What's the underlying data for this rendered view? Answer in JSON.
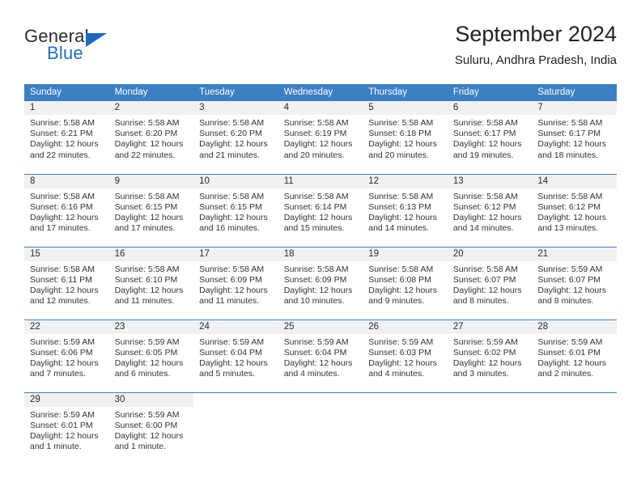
{
  "brand": {
    "line1": "General",
    "line2": "Blue",
    "accent_color": "#1a69bd"
  },
  "header": {
    "title": "September 2024",
    "subtitle": "Suluru, Andhra Pradesh, India"
  },
  "grid": {
    "header_bg": "#3b7fc4",
    "daynum_bg": "#f1f1f1",
    "weekdays": [
      "Sunday",
      "Monday",
      "Tuesday",
      "Wednesday",
      "Thursday",
      "Friday",
      "Saturday"
    ]
  },
  "weeks": [
    [
      {
        "day": "1",
        "sunrise": "Sunrise: 5:58 AM",
        "sunset": "Sunset: 6:21 PM",
        "daylight1": "Daylight: 12 hours",
        "daylight2": "and 22 minutes."
      },
      {
        "day": "2",
        "sunrise": "Sunrise: 5:58 AM",
        "sunset": "Sunset: 6:20 PM",
        "daylight1": "Daylight: 12 hours",
        "daylight2": "and 22 minutes."
      },
      {
        "day": "3",
        "sunrise": "Sunrise: 5:58 AM",
        "sunset": "Sunset: 6:20 PM",
        "daylight1": "Daylight: 12 hours",
        "daylight2": "and 21 minutes."
      },
      {
        "day": "4",
        "sunrise": "Sunrise: 5:58 AM",
        "sunset": "Sunset: 6:19 PM",
        "daylight1": "Daylight: 12 hours",
        "daylight2": "and 20 minutes."
      },
      {
        "day": "5",
        "sunrise": "Sunrise: 5:58 AM",
        "sunset": "Sunset: 6:18 PM",
        "daylight1": "Daylight: 12 hours",
        "daylight2": "and 20 minutes."
      },
      {
        "day": "6",
        "sunrise": "Sunrise: 5:58 AM",
        "sunset": "Sunset: 6:17 PM",
        "daylight1": "Daylight: 12 hours",
        "daylight2": "and 19 minutes."
      },
      {
        "day": "7",
        "sunrise": "Sunrise: 5:58 AM",
        "sunset": "Sunset: 6:17 PM",
        "daylight1": "Daylight: 12 hours",
        "daylight2": "and 18 minutes."
      }
    ],
    [
      {
        "day": "8",
        "sunrise": "Sunrise: 5:58 AM",
        "sunset": "Sunset: 6:16 PM",
        "daylight1": "Daylight: 12 hours",
        "daylight2": "and 17 minutes."
      },
      {
        "day": "9",
        "sunrise": "Sunrise: 5:58 AM",
        "sunset": "Sunset: 6:15 PM",
        "daylight1": "Daylight: 12 hours",
        "daylight2": "and 17 minutes."
      },
      {
        "day": "10",
        "sunrise": "Sunrise: 5:58 AM",
        "sunset": "Sunset: 6:15 PM",
        "daylight1": "Daylight: 12 hours",
        "daylight2": "and 16 minutes."
      },
      {
        "day": "11",
        "sunrise": "Sunrise: 5:58 AM",
        "sunset": "Sunset: 6:14 PM",
        "daylight1": "Daylight: 12 hours",
        "daylight2": "and 15 minutes."
      },
      {
        "day": "12",
        "sunrise": "Sunrise: 5:58 AM",
        "sunset": "Sunset: 6:13 PM",
        "daylight1": "Daylight: 12 hours",
        "daylight2": "and 14 minutes."
      },
      {
        "day": "13",
        "sunrise": "Sunrise: 5:58 AM",
        "sunset": "Sunset: 6:12 PM",
        "daylight1": "Daylight: 12 hours",
        "daylight2": "and 14 minutes."
      },
      {
        "day": "14",
        "sunrise": "Sunrise: 5:58 AM",
        "sunset": "Sunset: 6:12 PM",
        "daylight1": "Daylight: 12 hours",
        "daylight2": "and 13 minutes."
      }
    ],
    [
      {
        "day": "15",
        "sunrise": "Sunrise: 5:58 AM",
        "sunset": "Sunset: 6:11 PM",
        "daylight1": "Daylight: 12 hours",
        "daylight2": "and 12 minutes."
      },
      {
        "day": "16",
        "sunrise": "Sunrise: 5:58 AM",
        "sunset": "Sunset: 6:10 PM",
        "daylight1": "Daylight: 12 hours",
        "daylight2": "and 11 minutes."
      },
      {
        "day": "17",
        "sunrise": "Sunrise: 5:58 AM",
        "sunset": "Sunset: 6:09 PM",
        "daylight1": "Daylight: 12 hours",
        "daylight2": "and 11 minutes."
      },
      {
        "day": "18",
        "sunrise": "Sunrise: 5:58 AM",
        "sunset": "Sunset: 6:09 PM",
        "daylight1": "Daylight: 12 hours",
        "daylight2": "and 10 minutes."
      },
      {
        "day": "19",
        "sunrise": "Sunrise: 5:58 AM",
        "sunset": "Sunset: 6:08 PM",
        "daylight1": "Daylight: 12 hours",
        "daylight2": "and 9 minutes."
      },
      {
        "day": "20",
        "sunrise": "Sunrise: 5:58 AM",
        "sunset": "Sunset: 6:07 PM",
        "daylight1": "Daylight: 12 hours",
        "daylight2": "and 8 minutes."
      },
      {
        "day": "21",
        "sunrise": "Sunrise: 5:59 AM",
        "sunset": "Sunset: 6:07 PM",
        "daylight1": "Daylight: 12 hours",
        "daylight2": "and 8 minutes."
      }
    ],
    [
      {
        "day": "22",
        "sunrise": "Sunrise: 5:59 AM",
        "sunset": "Sunset: 6:06 PM",
        "daylight1": "Daylight: 12 hours",
        "daylight2": "and 7 minutes."
      },
      {
        "day": "23",
        "sunrise": "Sunrise: 5:59 AM",
        "sunset": "Sunset: 6:05 PM",
        "daylight1": "Daylight: 12 hours",
        "daylight2": "and 6 minutes."
      },
      {
        "day": "24",
        "sunrise": "Sunrise: 5:59 AM",
        "sunset": "Sunset: 6:04 PM",
        "daylight1": "Daylight: 12 hours",
        "daylight2": "and 5 minutes."
      },
      {
        "day": "25",
        "sunrise": "Sunrise: 5:59 AM",
        "sunset": "Sunset: 6:04 PM",
        "daylight1": "Daylight: 12 hours",
        "daylight2": "and 4 minutes."
      },
      {
        "day": "26",
        "sunrise": "Sunrise: 5:59 AM",
        "sunset": "Sunset: 6:03 PM",
        "daylight1": "Daylight: 12 hours",
        "daylight2": "and 4 minutes."
      },
      {
        "day": "27",
        "sunrise": "Sunrise: 5:59 AM",
        "sunset": "Sunset: 6:02 PM",
        "daylight1": "Daylight: 12 hours",
        "daylight2": "and 3 minutes."
      },
      {
        "day": "28",
        "sunrise": "Sunrise: 5:59 AM",
        "sunset": "Sunset: 6:01 PM",
        "daylight1": "Daylight: 12 hours",
        "daylight2": "and 2 minutes."
      }
    ],
    [
      {
        "day": "29",
        "sunrise": "Sunrise: 5:59 AM",
        "sunset": "Sunset: 6:01 PM",
        "daylight1": "Daylight: 12 hours",
        "daylight2": "and 1 minute."
      },
      {
        "day": "30",
        "sunrise": "Sunrise: 5:59 AM",
        "sunset": "Sunset: 6:00 PM",
        "daylight1": "Daylight: 12 hours",
        "daylight2": "and 1 minute."
      },
      {
        "day": "",
        "sunrise": "",
        "sunset": "",
        "daylight1": "",
        "daylight2": ""
      },
      {
        "day": "",
        "sunrise": "",
        "sunset": "",
        "daylight1": "",
        "daylight2": ""
      },
      {
        "day": "",
        "sunrise": "",
        "sunset": "",
        "daylight1": "",
        "daylight2": ""
      },
      {
        "day": "",
        "sunrise": "",
        "sunset": "",
        "daylight1": "",
        "daylight2": ""
      },
      {
        "day": "",
        "sunrise": "",
        "sunset": "",
        "daylight1": "",
        "daylight2": ""
      }
    ]
  ]
}
